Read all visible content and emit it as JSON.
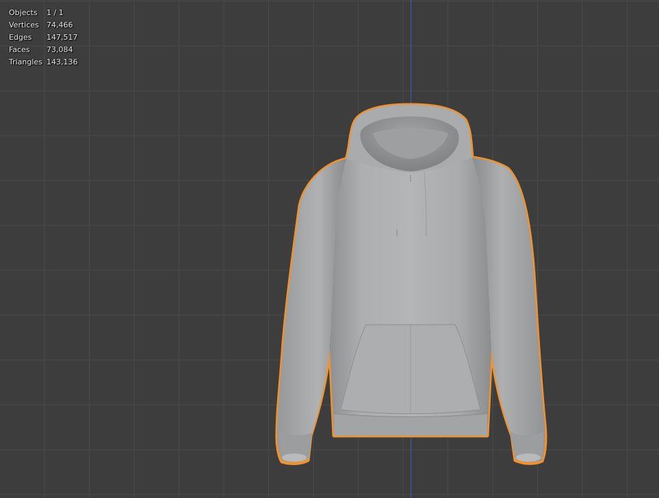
{
  "stats": [
    {
      "label": "Objects",
      "value": "1 / 1"
    },
    {
      "label": "Vertices",
      "value": "74,466"
    },
    {
      "label": "Edges",
      "value": "147,517"
    },
    {
      "label": "Faces",
      "value": "73,084"
    },
    {
      "label": "Triangles",
      "value": "143,136"
    }
  ],
  "colors": {
    "viewport_bg": "#3d3d3d",
    "grid_line": "#4a4a4a",
    "z_axis": "#2d63c8",
    "selection_outline": "#f0922e",
    "mesh": "#a9aaab"
  },
  "icons": [
    "hoodie-mesh"
  ]
}
